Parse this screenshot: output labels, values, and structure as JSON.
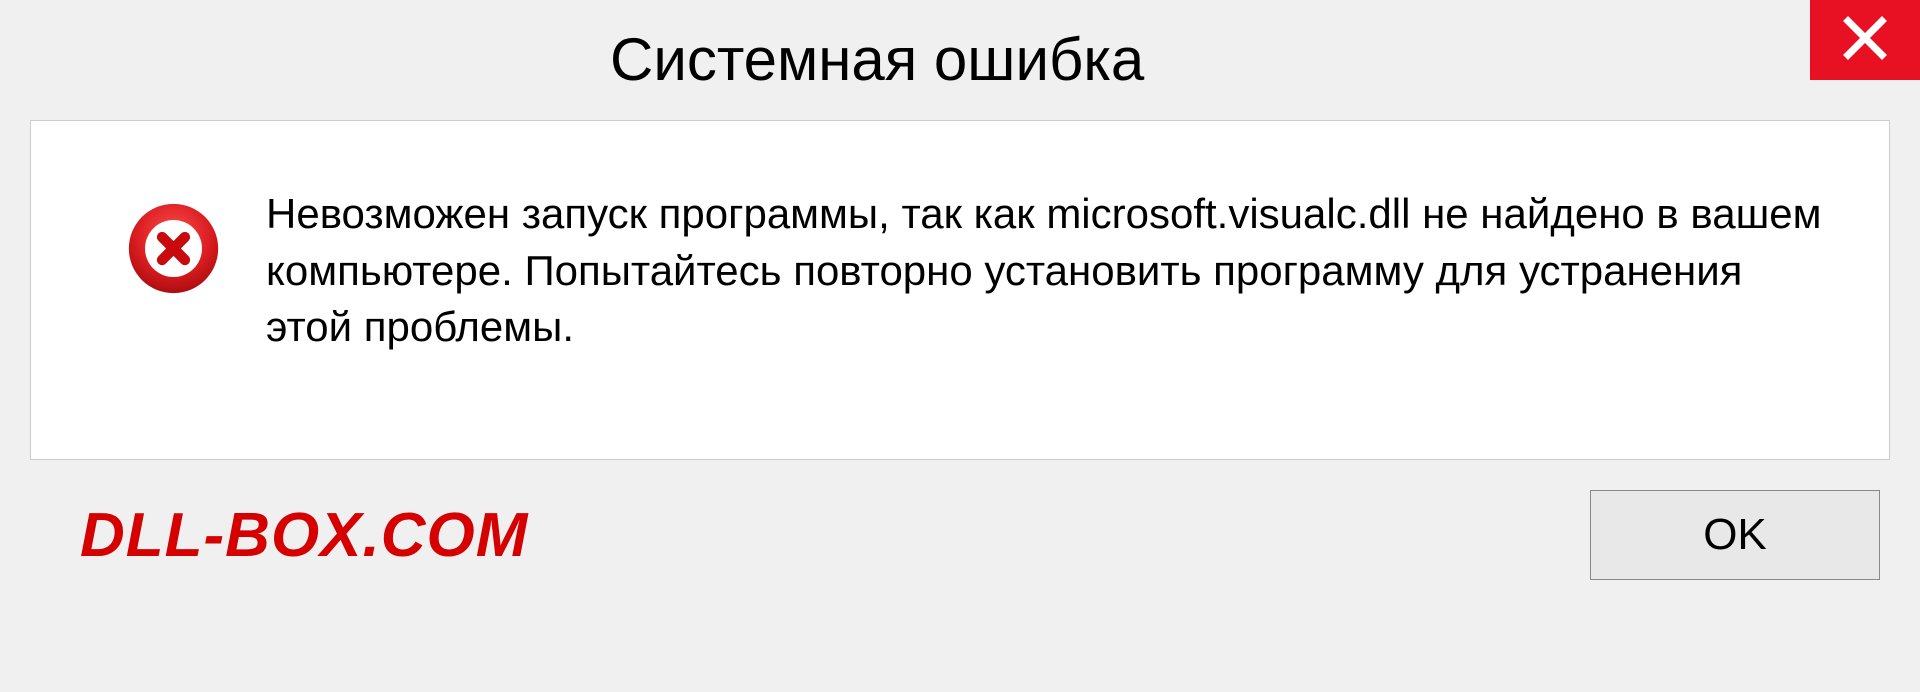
{
  "dialog": {
    "title": "Системная ошибка",
    "message": "Невозможен запуск программы, так как microsoft.visualc.dll  не найдено в вашем компьютере. Попытайтесь повторно установить программу для устранения этой проблемы.",
    "ok_label": "OK"
  },
  "watermark": "DLL-BOX.COM",
  "colors": {
    "close_bg": "#e81123",
    "error_ring": "#c80a0e",
    "watermark": "#d50000"
  }
}
